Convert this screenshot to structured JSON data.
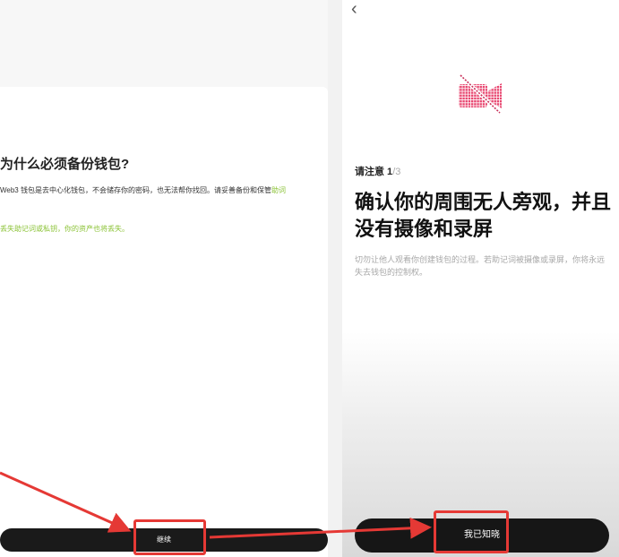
{
  "left_screen": {
    "title": "为什么必须备份钱包?",
    "description_plain": "Web3 钱包是去中心化钱包，不会储存你的密码，也无法帮你找回。请妥善备份和保管",
    "description_highlight": "助词",
    "warning": "丢失助记词或私钥，你的资产也将丢失。",
    "continue_button": "继续"
  },
  "right_screen": {
    "step_label": "请注意 1",
    "step_total": "/3",
    "headline": "确认你的周围无人旁观，并且没有摄像和录屏",
    "description": "切勿让他人观看你创建钱包的过程。若助记词被摄像或录屏，你将永远失去钱包的控制权。",
    "acknowledge_button": "我已知晓"
  },
  "icons": {
    "back": "chevron-left-icon",
    "camera_off": "camera-off-icon"
  },
  "colors": {
    "highlight_green": "#8ac234",
    "annotation_red": "#e53935",
    "icon_pink": "#e8456f",
    "button_dark": "#1a1a1a"
  }
}
